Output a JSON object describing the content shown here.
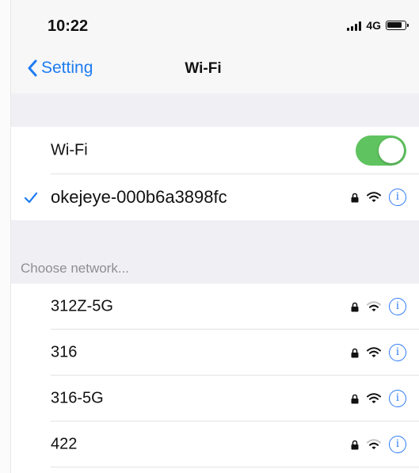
{
  "status_bar": {
    "time": "10:22",
    "network": "4G"
  },
  "nav": {
    "back_label": "Setting",
    "title": "Wi-Fi"
  },
  "wifi_toggle": {
    "label": "Wi-Fi",
    "state": "on"
  },
  "connected_network": {
    "name": "okejeye-000b6a3898fc",
    "secured": true,
    "info_icon_label": "i"
  },
  "choose_section": {
    "label": "Choose network..."
  },
  "networks": [
    {
      "name": "312Z-5G",
      "secured": true,
      "signal": "medium",
      "info": "i"
    },
    {
      "name": "316",
      "secured": true,
      "signal": "full",
      "info": "i"
    },
    {
      "name": "316-5G",
      "secured": true,
      "signal": "full",
      "info": "i"
    },
    {
      "name": "422",
      "secured": true,
      "signal": "medium",
      "info": "i"
    }
  ],
  "colors": {
    "accent_blue": "#1e7cf2",
    "toggle_green": "#5fc35f",
    "group_gray": "#efeff4"
  }
}
